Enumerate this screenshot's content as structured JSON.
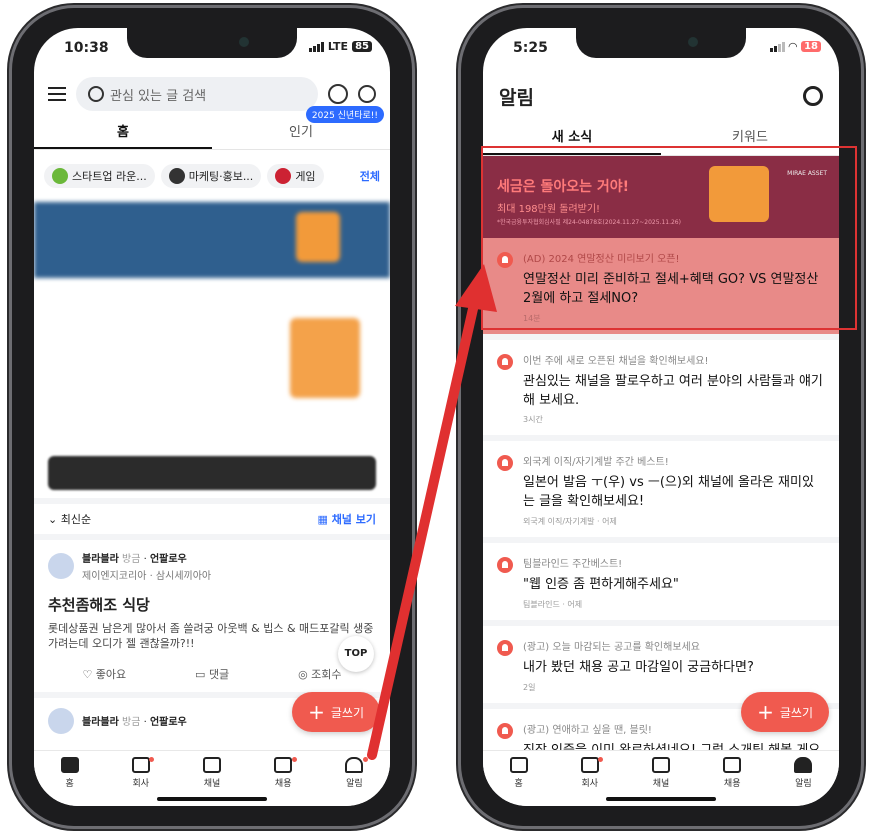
{
  "left": {
    "status": {
      "time": "10:38",
      "network": "LTE",
      "battery": "85"
    },
    "search_placeholder": "관심 있는 글 검색",
    "badge": "2025 신년타로!!",
    "tabs": [
      "홈",
      "인기"
    ],
    "chips": [
      "스타트업 라운...",
      "마케팅·홍보...",
      "게임"
    ],
    "chips_all": "전체",
    "sort_label": "최신순",
    "channel_view": "채널 보기",
    "post": {
      "author": "블라블라",
      "time": "방금",
      "tag": "언팔로우",
      "sub": "제이엔지코리아 · 삼시세끼아아",
      "title": "추천좀해조 식당",
      "body": "롯데상품권 남은게 많아서 좀 쓸려궁 아웃백 & 빕스 & 매드포갈릭 생중 가려는데 오디가 젤 괜찮을까?!!",
      "like": "좋아요",
      "comment": "댓글",
      "views": "조회수"
    },
    "post2": {
      "author": "블라블라",
      "time": "방금",
      "tag": "언팔로우"
    },
    "top_btn": "TOP",
    "fab": "글쓰기",
    "nav": [
      "홈",
      "회사",
      "채널",
      "채용",
      "알림"
    ]
  },
  "right": {
    "status": {
      "time": "5:25",
      "battery": "18"
    },
    "title": "알림",
    "tabs": [
      "새 소식",
      "키워드"
    ],
    "banner": {
      "line1": "세금은 돌아오는 거야!",
      "line2": "최대 198만원 돌려받기!",
      "line3": "*한국금융투자협회심사필 제24-04878호(2024.11.27~2025.11.26)",
      "logo": "MIRAE ASSET"
    },
    "notifications": [
      {
        "cat": "(AD) 2024 연말정산 미리보기 오픈!",
        "msg": "연말정산 미리 준비하고 절세+혜택 GO? VS 연말정산 2월에 하고 절세NO?",
        "time": "14분",
        "highlight": true
      },
      {
        "cat": "이번 주에 새로 오픈된 채널을 확인해보세요!",
        "msg": "관심있는 채널을 팔로우하고 여러 분야의 사람들과 얘기해 보세요.",
        "time": "3시간"
      },
      {
        "cat": "외국계 이직/자기계발 주간 베스트!",
        "msg": "일본어 발음 ㅜ(우) vs ㅡ(으)외 채널에 올라온 재미있는 글을 확인해보세요!",
        "time": "외국계 이직/자기계발 · 어제"
      },
      {
        "cat": "팀블라인드 주간베스트!",
        "msg": "\"웹 인증 좀 편하게해주세요\"",
        "time": "팀블라인드 · 어제"
      },
      {
        "cat": "(광고) 오늘 마감되는 공고를 확인해보세요",
        "msg": "내가 봤던 채용 공고 마감일이 궁금하다면?",
        "time": "2일"
      },
      {
        "cat": "(광고) 연애하고 싶을 땐, 블릿!",
        "msg": "직장 인증을 이미 완료하셨네요! 그럼 소개팅 해볼 게요💝",
        "time": ""
      }
    ],
    "fab": "글쓰기",
    "nav": [
      "홈",
      "회사",
      "채널",
      "채용",
      "알림"
    ]
  }
}
